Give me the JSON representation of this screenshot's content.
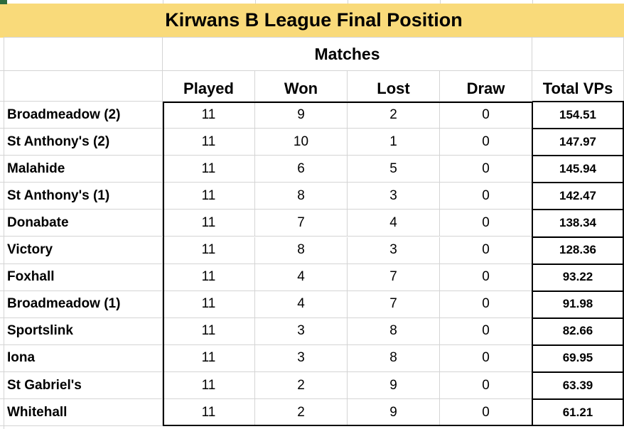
{
  "title": "Kirwans B League Final Position",
  "group_header": "Matches",
  "columns": [
    "Played",
    "Won",
    "Lost",
    "Draw",
    "Total VPs"
  ],
  "rows": [
    {
      "team": "Broadmeadow (2)",
      "played": "11",
      "won": "9",
      "lost": "2",
      "draw": "0",
      "vps": "154.51"
    },
    {
      "team": "St Anthony's (2)",
      "played": "11",
      "won": "10",
      "lost": "1",
      "draw": "0",
      "vps": "147.97"
    },
    {
      "team": "Malahide",
      "played": "11",
      "won": "6",
      "lost": "5",
      "draw": "0",
      "vps": "145.94"
    },
    {
      "team": "St Anthony's (1)",
      "played": "11",
      "won": "8",
      "lost": "3",
      "draw": "0",
      "vps": "142.47"
    },
    {
      "team": "Donabate",
      "played": "11",
      "won": "7",
      "lost": "4",
      "draw": "0",
      "vps": "138.34"
    },
    {
      "team": "Victory",
      "played": "11",
      "won": "8",
      "lost": "3",
      "draw": "0",
      "vps": "128.36"
    },
    {
      "team": "Foxhall",
      "played": "11",
      "won": "4",
      "lost": "7",
      "draw": "0",
      "vps": "93.22"
    },
    {
      "team": "Broadmeadow (1)",
      "played": "11",
      "won": "4",
      "lost": "7",
      "draw": "0",
      "vps": "91.98"
    },
    {
      "team": "Sportslink",
      "played": "11",
      "won": "3",
      "lost": "8",
      "draw": "0",
      "vps": "82.66"
    },
    {
      "team": "Iona",
      "played": "11",
      "won": "3",
      "lost": "8",
      "draw": "0",
      "vps": "69.95"
    },
    {
      "team": "St Gabriel's",
      "played": "11",
      "won": "2",
      "lost": "9",
      "draw": "0",
      "vps": "63.39"
    },
    {
      "team": "Whitehall",
      "played": "11",
      "won": "2",
      "lost": "9",
      "draw": "0",
      "vps": "61.21"
    }
  ],
  "colors": {
    "title_fill": "#f9da7a",
    "gridline": "#d4d4d4",
    "selection_marker": "#2e6b3d"
  }
}
